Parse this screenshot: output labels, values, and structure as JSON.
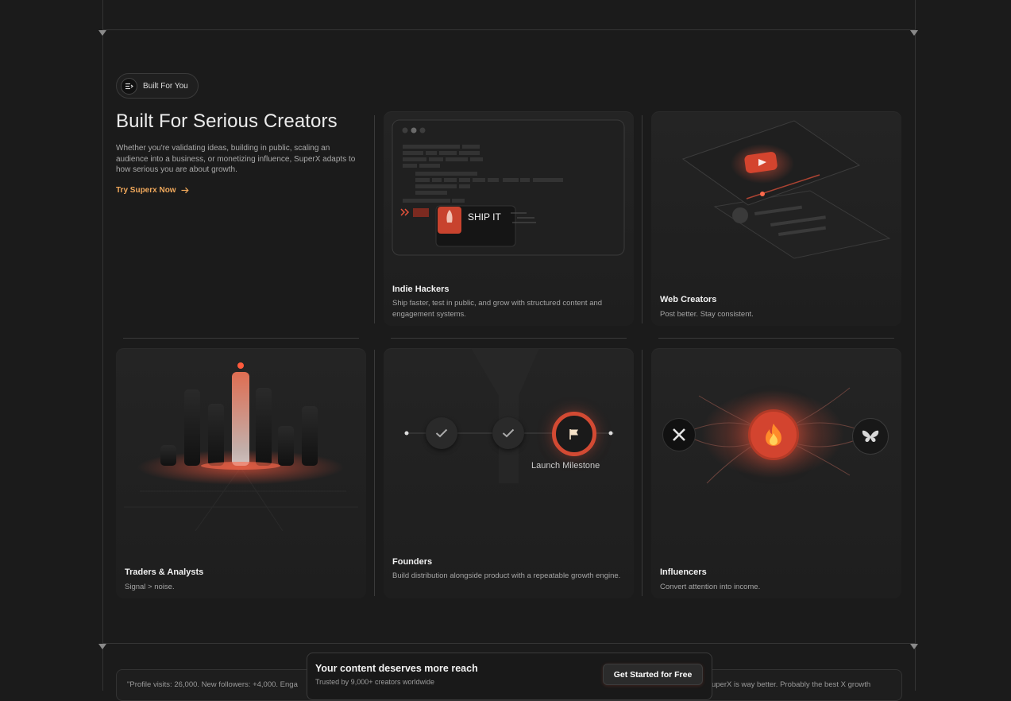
{
  "badge": {
    "label": "Built For You",
    "icon": "list-icon"
  },
  "hero": {
    "title": "Built For Serious Creators",
    "description": "Whether you're validating ideas, building in public, scaling an audience into a business, or monetizing influence, SuperX adapts to how serious you are about growth.",
    "cta_label": "Try Superx Now"
  },
  "cards": {
    "indie": {
      "title": "Indie Hackers",
      "desc": "Ship faster, test in public, and grow with structured content and engagement systems.",
      "ship_label": "SHIP IT"
    },
    "web": {
      "title": "Web Creators",
      "desc": "Post better. Stay consistent."
    },
    "traders": {
      "title": "Traders & Analysts",
      "desc": "Signal > noise."
    },
    "founders": {
      "title": "Founders",
      "desc": "Build distribution alongside product with a repeatable growth engine.",
      "milestone_label": "Launch Milestone"
    },
    "influencers": {
      "title": "Influencers",
      "desc": "Convert attention into income."
    }
  },
  "bottom": {
    "quote_left": "\"Profile visits: 26,000. New followers: +4,000. Enga",
    "quote_right": "uperX is way better. Probably the best X growth"
  },
  "popup": {
    "title": "Your content deserves more reach",
    "subtitle": "Trusted by 9,000+ creators worldwide",
    "button": "Get Started for Free"
  },
  "colors": {
    "accent": "#e8533b",
    "cta": "#f0a85b",
    "bg": "#1b1b1b"
  }
}
